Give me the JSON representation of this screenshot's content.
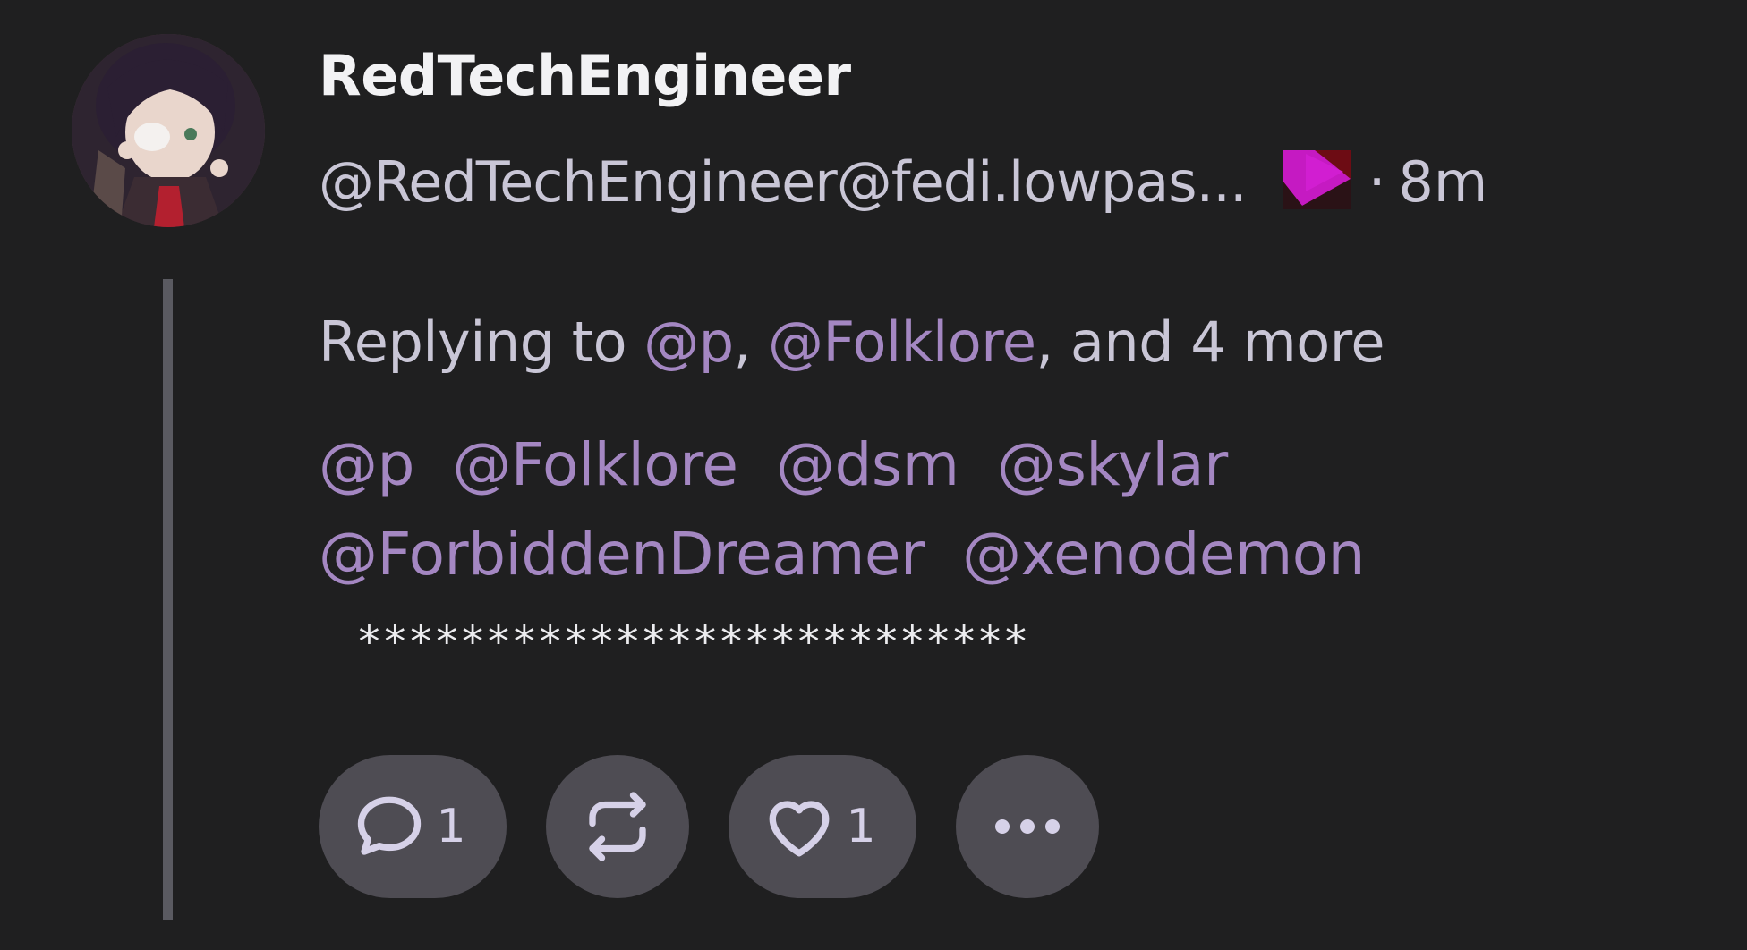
{
  "post": {
    "display_name": "RedTechEngineer",
    "handle": "@RedTechEngineer@fedi.lowpas...",
    "separator": "·",
    "time_ago": "8m",
    "reply_prefix": "Replying to ",
    "reply_mentions": [
      "@p",
      "@Folklore"
    ],
    "reply_comma": ", ",
    "reply_suffix": ", and 4 more",
    "mentions": [
      "@p",
      "@Folklore",
      "@dsm",
      "@skylar",
      "@ForbiddenDreamer",
      "@xenodemon"
    ],
    "body": "**************************"
  },
  "actions": {
    "reply_count": "1",
    "like_count": "1"
  },
  "colors": {
    "background": "#1f1f20",
    "mention": "#a487c2",
    "button": "#4e4c53",
    "icon": "#d6d1e8"
  },
  "icons": {
    "avatar": "anime-avatar",
    "server": "pleroma-server-icon",
    "reply": "speech-bubble-icon",
    "repost": "repeat-icon",
    "like": "heart-icon",
    "more": "ellipsis-icon"
  }
}
